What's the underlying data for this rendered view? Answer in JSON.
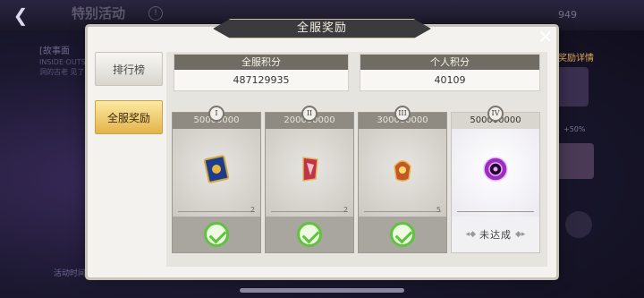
{
  "background": {
    "title": "特别活动",
    "help_glyph": "!",
    "currency": "949",
    "story_label": "[故事面",
    "desc": "INSIDE·OUTSIDE 洞的古老 见了",
    "right_link": "奖励详情",
    "percent_label": "+50%",
    "time_label": "活动时间"
  },
  "modal": {
    "title": "全服奖励",
    "close_glyph": "✕"
  },
  "sidebar": {
    "tabs": [
      {
        "label": "排行榜",
        "active": false
      },
      {
        "label": "全服奖励",
        "active": true
      }
    ]
  },
  "scores": {
    "server_label": "全服积分",
    "server_value": "487129935",
    "personal_label": "个人积分",
    "personal_value": "40109"
  },
  "rewards": [
    {
      "tier": "I",
      "threshold": "50000000",
      "count": "2",
      "status": "claimed",
      "item_icon": "card-item-icon"
    },
    {
      "tier": "II",
      "threshold": "200000000",
      "count": "2",
      "status": "claimed",
      "item_icon": "crest-item-icon"
    },
    {
      "tier": "III",
      "threshold": "300000000",
      "count": "5",
      "status": "claimed",
      "item_icon": "lantern-item-icon"
    },
    {
      "tier": "IV",
      "threshold": "500000000",
      "count": "",
      "status": "未达成",
      "item_icon": "orb-item-icon"
    }
  ],
  "colors": {
    "accent_gold": "#e3b44a",
    "check_green": "#5fc33b"
  }
}
